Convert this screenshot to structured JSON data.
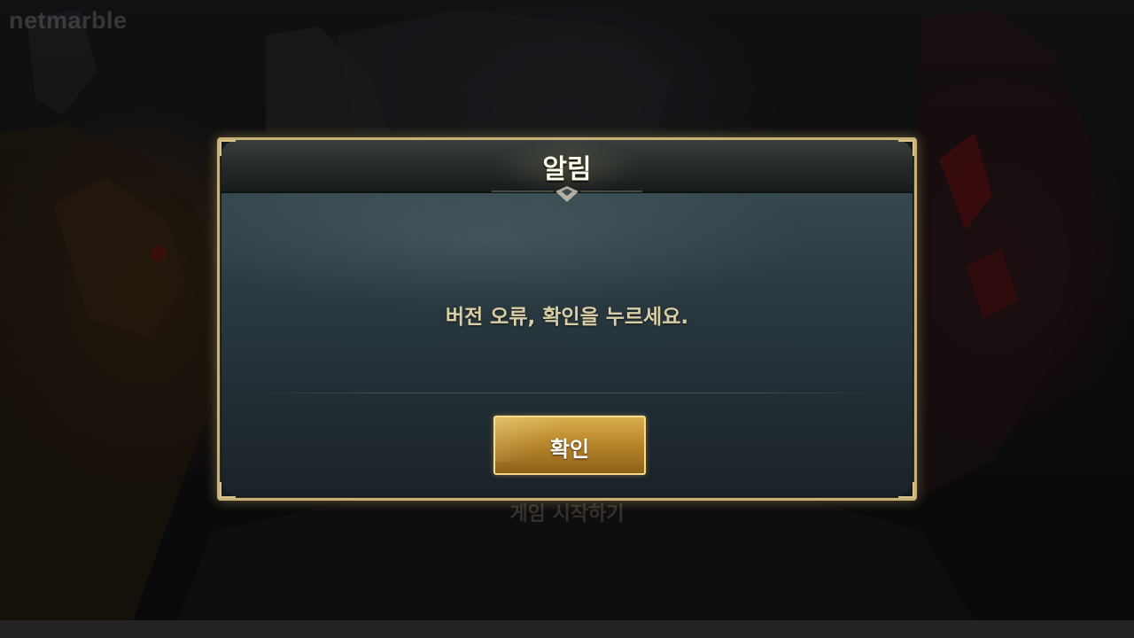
{
  "brand": {
    "logo_text": "netmarble"
  },
  "background": {
    "start_button_label": "게임 시작하기"
  },
  "dialog": {
    "title": "알림",
    "message": "버전 오류, 확인을 누르세요.",
    "confirm_label": "확인"
  },
  "colors": {
    "dialog_border": "#c8b27a",
    "title_text": "#fffbe9",
    "message_text": "#d9cfa7",
    "button_gold": "#b9882c"
  }
}
